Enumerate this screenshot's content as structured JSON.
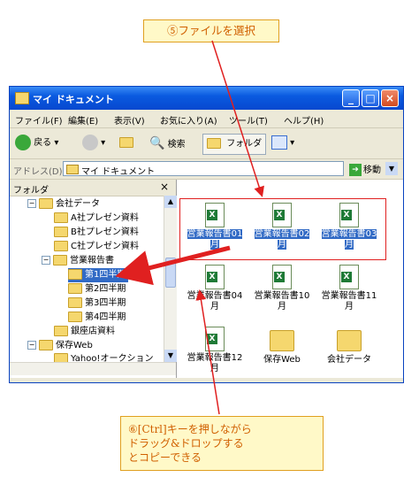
{
  "callouts": {
    "top": "⑤ファイルを選択",
    "bottom_lines": [
      "⑥[Ctrl]キーを押しながら",
      "ドラッグ&ドロップする",
      "とコピーできる"
    ]
  },
  "window": {
    "title": "マイ ドキュメント",
    "controls": {
      "min": "_",
      "max": "□",
      "close": "×"
    }
  },
  "menu": [
    "ファイル(F)",
    "編集(E)",
    "表示(V)",
    "お気に入り(A)",
    "ツール(T)",
    "ヘルプ(H)"
  ],
  "toolbar": {
    "back": "戻る",
    "search": "検索",
    "folders": "フォルダ"
  },
  "address": {
    "label": "アドレス(D)",
    "value": "マイ ドキュメント",
    "go": "移動"
  },
  "folder_pane": {
    "header": "フォルダ",
    "close": "×",
    "items": [
      {
        "label": "会社データ",
        "expand": "⊟"
      },
      {
        "label": "A社プレゼン資料"
      },
      {
        "label": "B社プレゼン資料"
      },
      {
        "label": "C社プレゼン資料"
      },
      {
        "label": "営業報告書",
        "expand": "⊟"
      },
      {
        "label": "第1四半期"
      },
      {
        "label": "第2四半期"
      },
      {
        "label": "第3四半期"
      },
      {
        "label": "第4四半期"
      },
      {
        "label": "銀座店資料"
      },
      {
        "label": "保存Web",
        "expand": "⊟"
      },
      {
        "label": "Yahoo!オークション"
      }
    ]
  },
  "files": [
    {
      "name": "営業報告書01\n月",
      "selected": true
    },
    {
      "name": "営業報告書02\n月",
      "selected": true
    },
    {
      "name": "営業報告書03\n月",
      "selected": true
    },
    {
      "name": "営業報告書04\n月"
    },
    {
      "name": "営業報告書10\n月"
    },
    {
      "name": "営業報告書11\n月"
    },
    {
      "name": "営業報告書12\n月"
    },
    {
      "name": "保存Web"
    },
    {
      "name": "会社データ"
    }
  ],
  "colors": {
    "accent_red": "#e02020",
    "callout_text": "#d06000",
    "title_blue": "#0a5ae0",
    "selection": "#316ac5"
  }
}
